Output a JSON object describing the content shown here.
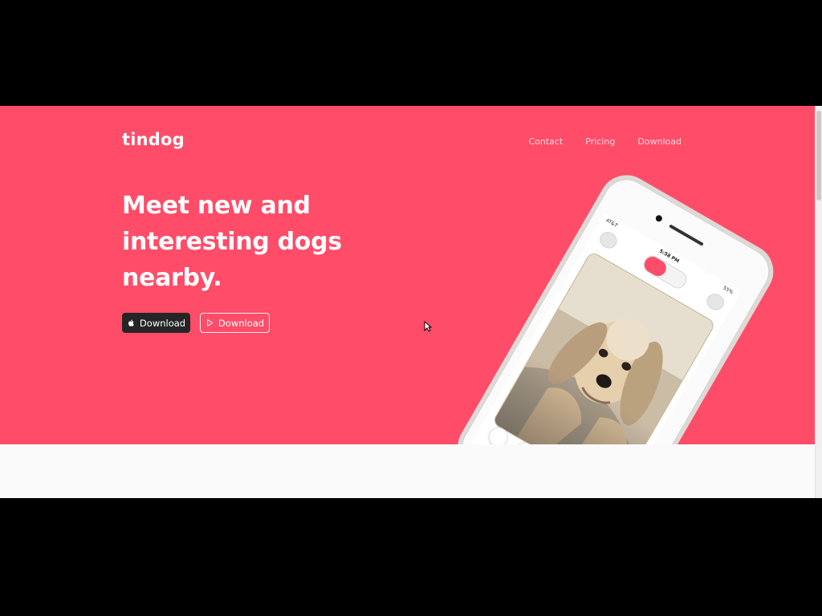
{
  "brand": {
    "name": "tindog"
  },
  "nav": {
    "items": [
      {
        "label": "Contact"
      },
      {
        "label": "Pricing"
      },
      {
        "label": "Download"
      }
    ]
  },
  "hero": {
    "headline": "Meet new and interesting dogs nearby.",
    "buttons": {
      "app_store": {
        "label": "Download",
        "icon": "apple-icon"
      },
      "google_play": {
        "label": "Download",
        "icon": "play-store-icon"
      }
    }
  },
  "phone": {
    "carrier": "AT&T",
    "time": "5:58 PM",
    "battery": "55%"
  },
  "colors": {
    "hero_background": "#ff4c68",
    "dark_button": "#252525",
    "page_background": "#fafafa",
    "outer_background": "#000000"
  }
}
